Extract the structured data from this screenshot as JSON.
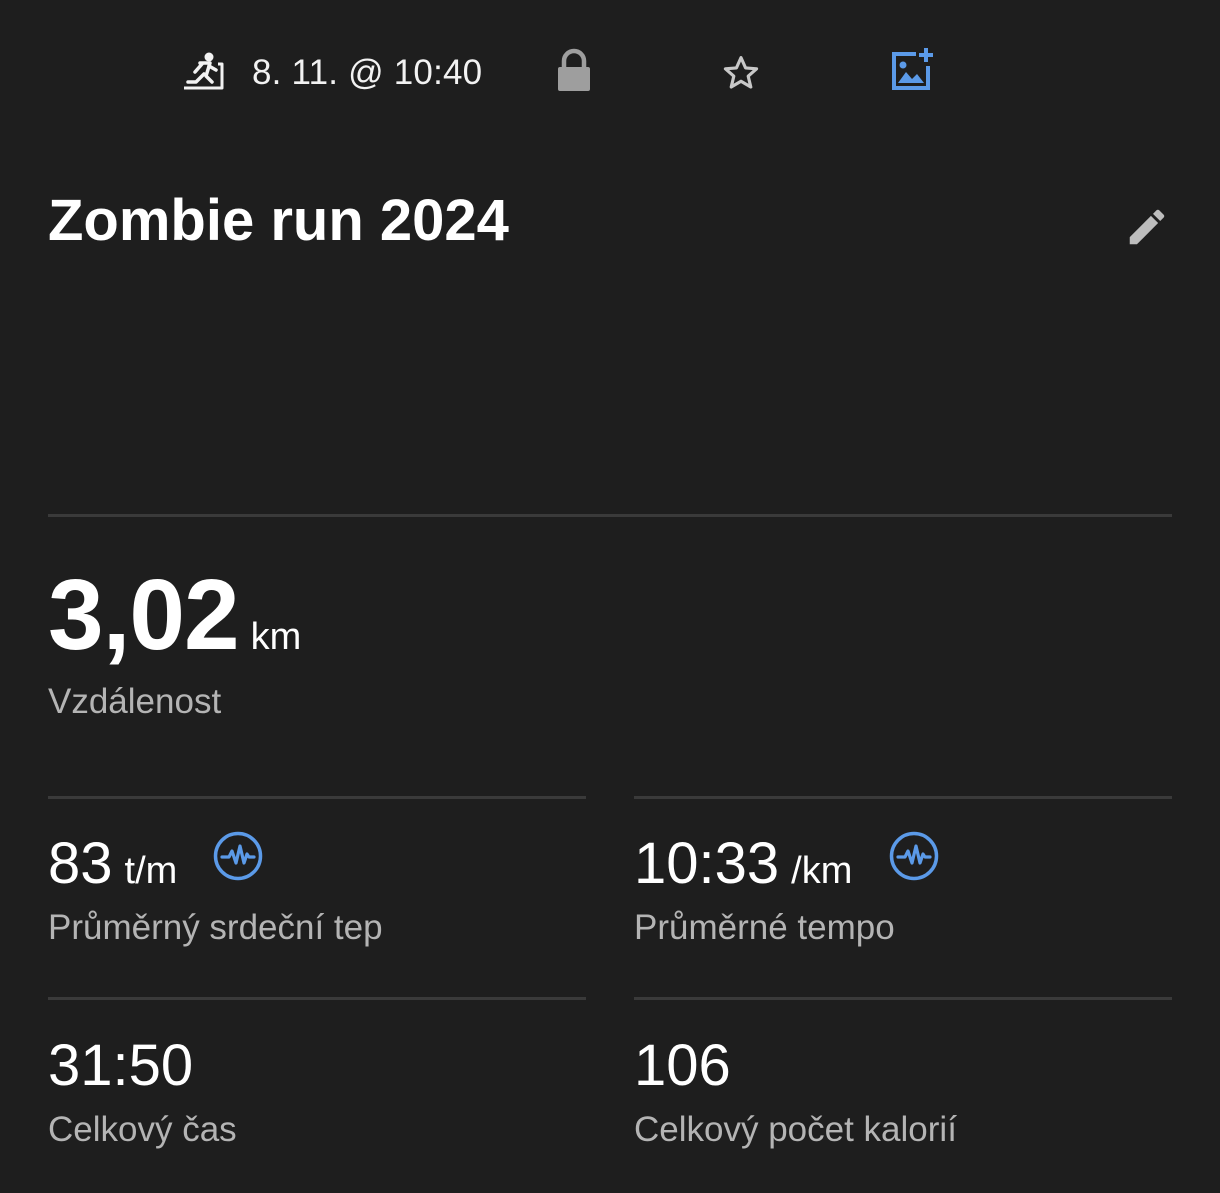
{
  "header": {
    "activity_icon": "treadmill-run-icon",
    "datetime": "8. 11. @ 10:40",
    "privacy_icon": "lock-icon",
    "favorite_icon": "star-outline-icon",
    "add_photo_icon": "add-photo-icon"
  },
  "activity": {
    "title": "Zombie run 2024",
    "edit_icon": "pencil-icon"
  },
  "distance": {
    "value": "3,02",
    "unit": "km",
    "label": "Vzdálenost"
  },
  "stats": [
    {
      "value": "83",
      "unit": "t/m",
      "label": "Průměrný srdeční tep",
      "icon": "heart-rate-icon"
    },
    {
      "value": "10:33",
      "unit": "/km",
      "label": "Průměrné tempo",
      "icon": "heart-rate-icon"
    },
    {
      "value": "31:50",
      "unit": "",
      "label": "Celkový čas"
    },
    {
      "value": "106",
      "unit": "",
      "label": "Celkový počet kalorií"
    }
  ],
  "colors": {
    "background": "#1e1e1e",
    "accent_blue": "#5b9ae8",
    "divider": "#3a3a3a",
    "secondary_text": "#b4b4b4"
  }
}
